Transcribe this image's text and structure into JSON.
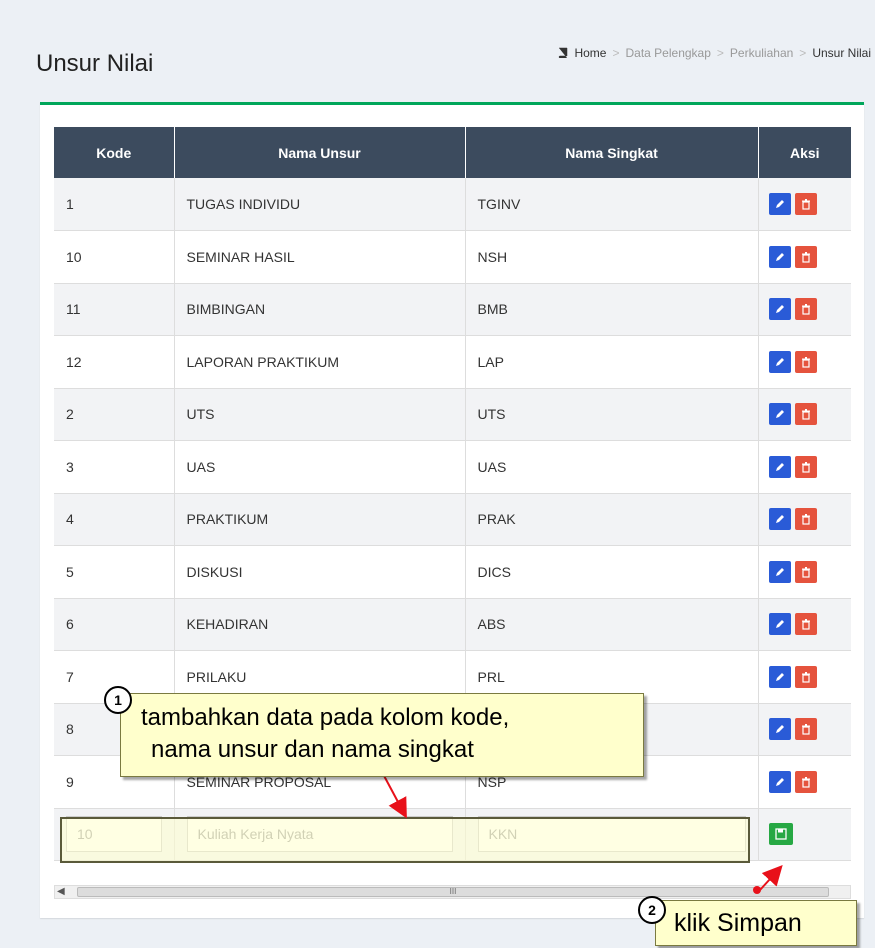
{
  "header": {
    "title": "Unsur Nilai",
    "breadcrumb": [
      "Home",
      "Data Pelengkap",
      "Perkuliahan",
      "Unsur Nilai"
    ],
    "breadcrumb_sep": ">"
  },
  "table": {
    "columns": [
      "Kode",
      "Nama Unsur",
      "Nama Singkat",
      "Aksi"
    ],
    "rows": [
      {
        "kode": "1",
        "nama": "TUGAS INDIVIDU",
        "singkat": "TGINV"
      },
      {
        "kode": "10",
        "nama": "SEMINAR HASIL",
        "singkat": "NSH"
      },
      {
        "kode": "11",
        "nama": "BIMBINGAN",
        "singkat": "BMB"
      },
      {
        "kode": "12",
        "nama": "LAPORAN PRAKTIKUM",
        "singkat": "LAP"
      },
      {
        "kode": "2",
        "nama": "UTS",
        "singkat": "UTS"
      },
      {
        "kode": "3",
        "nama": "UAS",
        "singkat": "UAS"
      },
      {
        "kode": "4",
        "nama": "PRAKTIKUM",
        "singkat": "PRAK"
      },
      {
        "kode": "5",
        "nama": "DISKUSI",
        "singkat": "DICS"
      },
      {
        "kode": "6",
        "nama": "KEHADIRAN",
        "singkat": "ABS"
      },
      {
        "kode": "7",
        "nama": "PRILAKU",
        "singkat": "PRL"
      },
      {
        "kode": "8",
        "nama": "",
        "singkat": ""
      },
      {
        "kode": "9",
        "nama": "SEMINAR PROPOSAL",
        "singkat": "NSP"
      }
    ],
    "input": {
      "kode": "10",
      "nama": "Kuliah Kerja Nyata",
      "singkat": "KKN"
    }
  },
  "icons": {
    "edit": "pencil-icon",
    "delete": "trash-icon",
    "save": "floppy-disk-icon",
    "breadcrumb": "book-icon"
  },
  "colors": {
    "header_bg": "#3c4b5e",
    "box_border": "#00a65a",
    "edit_btn": "#2a5bd7",
    "delete_btn": "#e5533d",
    "save_btn": "#27a844",
    "callout_bg": "#ffffcc"
  },
  "annotations": {
    "step1_num": "1",
    "step1_line1": "tambahkan data pada kolom kode,",
    "step1_line2": "nama unsur dan nama singkat",
    "step2_num": "2",
    "step2_text": "klik Simpan"
  }
}
